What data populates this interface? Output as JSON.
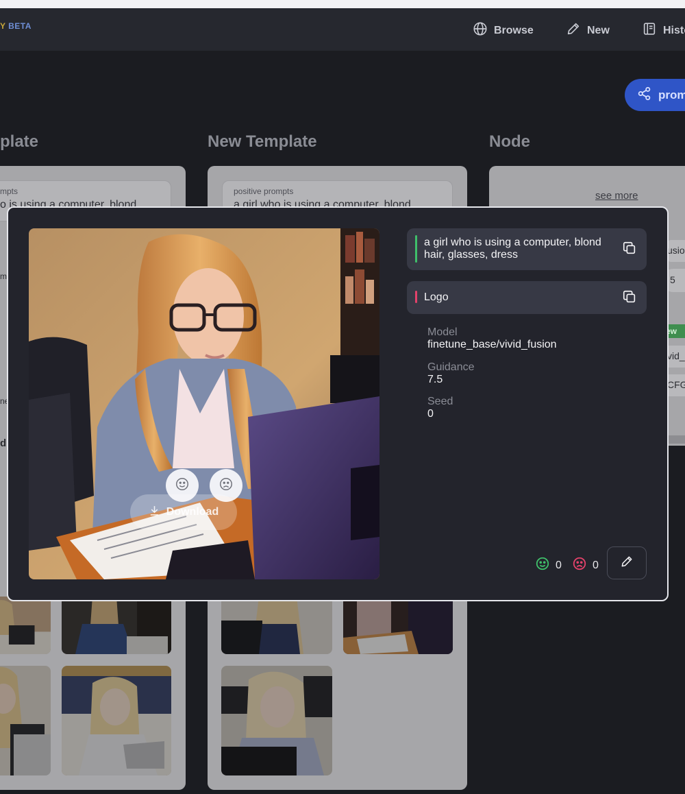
{
  "nav": {
    "logo_letter": "Y",
    "logo_beta": "BETA",
    "items": [
      {
        "label": "Browse",
        "icon": "globe-icon"
      },
      {
        "label": "New",
        "icon": "pencil-icon"
      },
      {
        "label": "Histo",
        "icon": "book-icon"
      }
    ]
  },
  "share_button": {
    "label": "prom",
    "icon": "share-icon"
  },
  "columns": [
    {
      "title": "plate"
    },
    {
      "title": "New Template"
    },
    {
      "title": "Node"
    }
  ],
  "background_cards": {
    "left": {
      "prompt_label": "mpts",
      "prompt_text": "o is using a computer, blond",
      "prompt_text_2": "e"
    },
    "middle": {
      "prompt_label": "positive prompts",
      "prompt_text": "a girl who is using a computer, blond"
    },
    "right": {
      "see_more": "see more",
      "fragments": [
        "usio",
        "5",
        "ew",
        "vid_",
        "CFG"
      ]
    },
    "left_fragments": [
      "m",
      "ne",
      "d"
    ]
  },
  "modal": {
    "image_alt": "girl with blond hair and glasses using a computer",
    "like_icon": "smile-icon",
    "dislike_icon": "frown-icon",
    "download_label": "Download",
    "positive_prompt": "a girl who is using a computer, blond hair, glasses, dress",
    "negative_prompt": "Logo",
    "positive_color": "#3fbf6a",
    "negative_color": "#e3426b",
    "meta": [
      {
        "label": "Model",
        "value": "finetune_base/vivid_fusion"
      },
      {
        "label": "Guidance",
        "value": "7.5"
      },
      {
        "label": "Seed",
        "value": "0"
      }
    ],
    "likes": "0",
    "dislikes": "0",
    "edit_icon": "pencil-icon"
  },
  "colors": {
    "accent_blue": "#2f55c7",
    "like_green": "#3fbf6a",
    "dislike_red": "#e3426b"
  }
}
